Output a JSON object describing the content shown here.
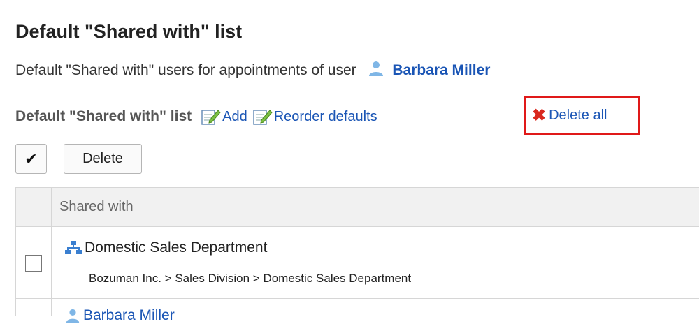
{
  "page": {
    "title": "Default \"Shared with\" list",
    "subtitle_text": "Default \"Shared with\" users for appointments of user",
    "user_name": "Barbara Miller"
  },
  "toolbar": {
    "label": "Default \"Shared with\" list",
    "add_label": "Add",
    "reorder_label": "Reorder defaults",
    "delete_all_label": "Delete all"
  },
  "actions": {
    "select_all_glyph": "✔",
    "delete_label": "Delete"
  },
  "table": {
    "column_header": "Shared with",
    "rows": [
      {
        "name": "Domestic Sales Department",
        "path": "Bozuman Inc. > Sales Division > Domestic Sales Department",
        "icon": "org-icon"
      },
      {
        "name": "Barbara Miller",
        "icon": "user-icon"
      }
    ]
  },
  "colors": {
    "link": "#1a55b5",
    "highlight_border": "#e01919",
    "delete_x": "#d9281e"
  }
}
